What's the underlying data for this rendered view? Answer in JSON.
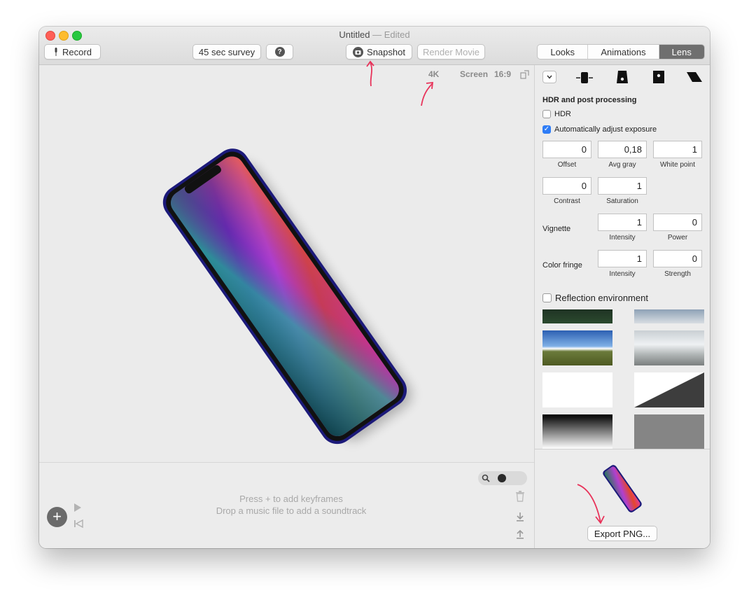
{
  "window": {
    "title": "Untitled",
    "title_status": "— Edited"
  },
  "toolbar": {
    "record_label": "Record",
    "survey_label": "45 sec survey",
    "help_label": "?",
    "snapshot_label": "Snapshot",
    "render_movie_label": "Render Movie",
    "tabs": [
      {
        "label": "Looks",
        "active": false
      },
      {
        "label": "Animations",
        "active": false
      },
      {
        "label": "Lens",
        "active": true
      }
    ]
  },
  "viewport": {
    "resolution": "4K",
    "screen_label": "Screen",
    "aspect": "16:9"
  },
  "timeline": {
    "hint_keyframes": "Press + to add keyframes",
    "hint_music": "Drop a music file to add a soundtrack"
  },
  "panel": {
    "section_title": "HDR and post processing",
    "hdr_label": "HDR",
    "hdr_checked": false,
    "auto_exposure_label": "Automatically adjust exposure",
    "auto_exposure_checked": true,
    "fields": {
      "offset": {
        "value": "0",
        "label": "Offset"
      },
      "avg_gray": {
        "value": "0,18",
        "label": "Avg gray"
      },
      "white_point": {
        "value": "1",
        "label": "White point"
      },
      "contrast": {
        "value": "0",
        "label": "Contrast"
      },
      "saturation": {
        "value": "1",
        "label": "Saturation"
      }
    },
    "vignette": {
      "label": "Vignette",
      "intensity": "1",
      "intensity_label": "Intensity",
      "power": "0",
      "power_label": "Power"
    },
    "color_fringe": {
      "label": "Color fringe",
      "intensity": "1",
      "intensity_label": "Intensity",
      "strength": "0",
      "strength_label": "Strength"
    },
    "reflection_label": "Reflection environment",
    "reflection_checked": false,
    "export_label": "Export PNG..."
  },
  "colors": {
    "accent": "#2f7df6",
    "annotation": "#e8335a",
    "active_tab": "#6f6f6f"
  }
}
